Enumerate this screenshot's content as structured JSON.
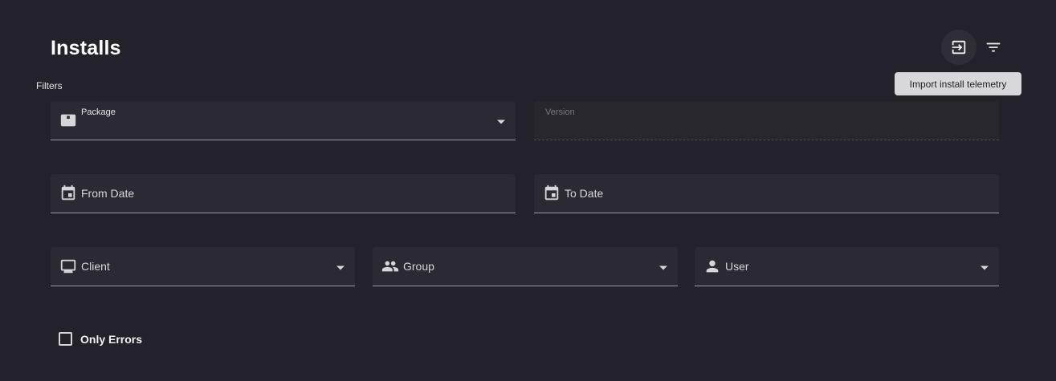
{
  "header": {
    "title": "Installs",
    "filters_label": "Filters"
  },
  "toolbar": {
    "import_icon": "import-icon",
    "filter_icon": "filter-list-icon",
    "tooltip": "Import install telemetry"
  },
  "fields": {
    "package": {
      "label": "Package",
      "icon": "package-icon",
      "value": ""
    },
    "version": {
      "label": "Version",
      "value": ""
    },
    "from_date": {
      "label": "From Date",
      "icon": "calendar-icon"
    },
    "to_date": {
      "label": "To Date",
      "icon": "calendar-icon"
    },
    "client": {
      "label": "Client",
      "icon": "monitor-icon"
    },
    "group": {
      "label": "Group",
      "icon": "group-icon"
    },
    "user": {
      "label": "User",
      "icon": "person-icon"
    }
  },
  "only_errors": {
    "label": "Only Errors",
    "checked": false
  },
  "colors": {
    "background": "#23222a",
    "field_background": "#2b2a33",
    "tooltip_background": "#d8d7db"
  }
}
